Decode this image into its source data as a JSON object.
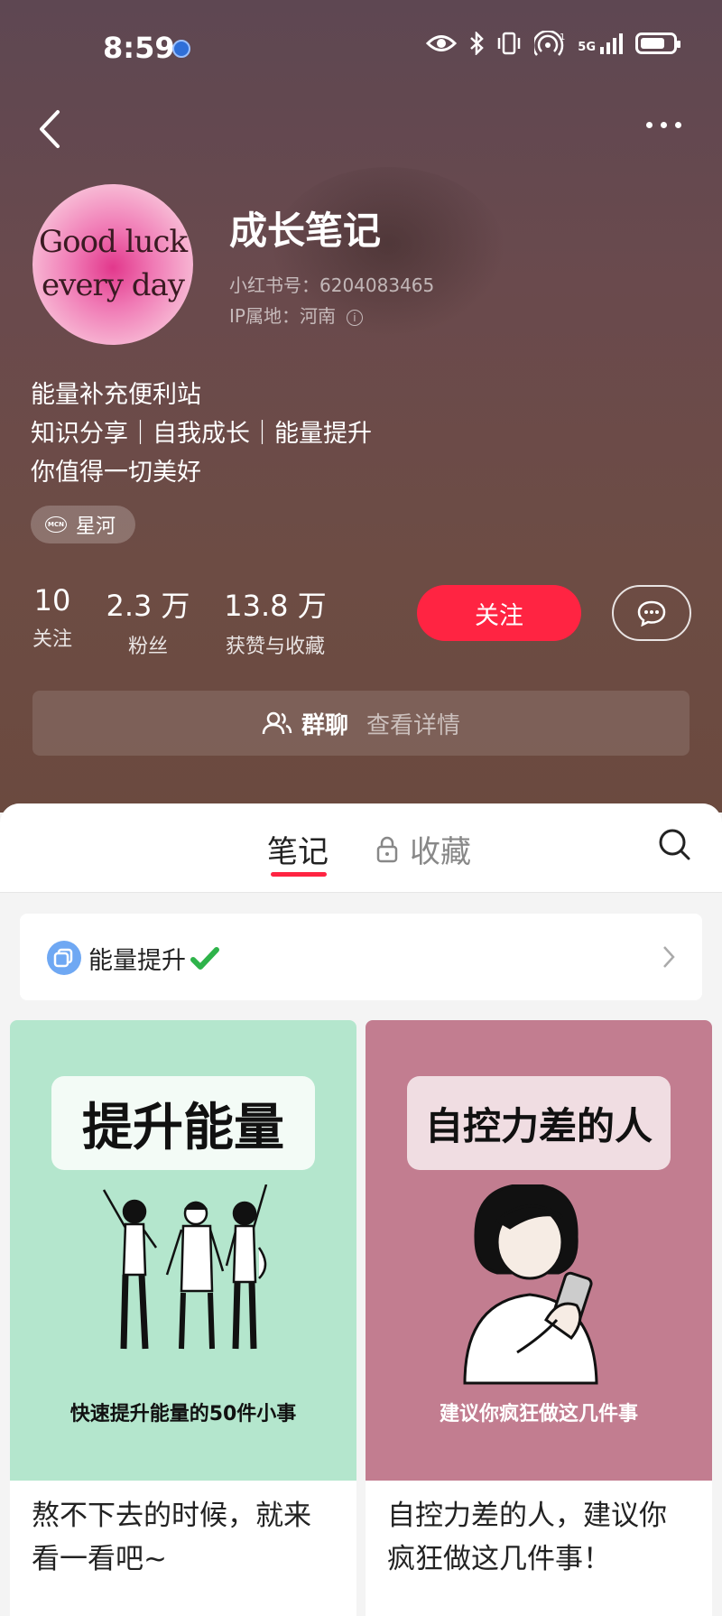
{
  "status_bar": {
    "time": "8:59",
    "network": "5G"
  },
  "profile": {
    "avatar_line1": "Good luck",
    "avatar_line2": "every day",
    "name": "成长笔记",
    "xhs_id": "小红书号：6204083465",
    "ip": "IP属地：河南",
    "bio": [
      "能量补充便利站",
      "知识分享｜自我成长｜能量提升",
      "你值得一切美好"
    ],
    "tag_label": "星河",
    "stats": [
      {
        "num": "10",
        "label": "关注"
      },
      {
        "num": "2.3 万",
        "label": "粉丝"
      },
      {
        "num": "13.8 万",
        "label": "获赞与收藏"
      }
    ],
    "follow_label": "关注",
    "group_title": "群聊",
    "group_detail": "查看详情"
  },
  "tabs": {
    "notes": "笔记",
    "favorites": "收藏"
  },
  "collection": {
    "title": "能量提升"
  },
  "cards": [
    {
      "cover_title": "提升能量",
      "cover_sub": "快速提升能量的50件小事",
      "title": "熬不下去的时候，就来看一看吧~"
    },
    {
      "cover_title": "自控力差的人",
      "cover_sub": "建议你疯狂做这几件事",
      "title": "自控力差的人，建议你疯狂做这几件事！"
    }
  ],
  "colors": {
    "accent": "#ff2442",
    "card1_bg": "#b4e6cd",
    "card2_bg": "#c27d90"
  }
}
